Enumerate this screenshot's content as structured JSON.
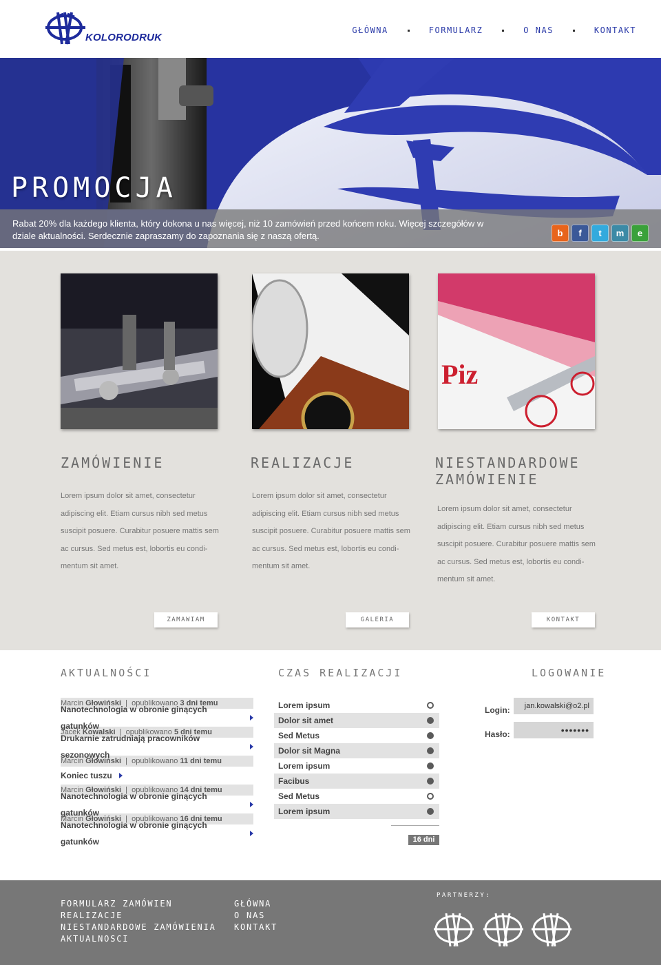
{
  "brand": {
    "name": "KOLORODRUK",
    "color": "#1e2b9c"
  },
  "nav": {
    "items": [
      "GŁÓWNA",
      "FORMULARZ",
      "O NAS",
      "KONTAKT"
    ]
  },
  "hero": {
    "title": "PROMOCJA",
    "text": "Rabat 20% dla każdego klienta, który dokona u nas więcej, niż 10 zamówień przed końcem roku. Więcej szczegółów w dziale aktualności. Serdecznie zapraszamy do zapoznania się z naszą ofertą.",
    "social": [
      {
        "icon": "blogger-icon",
        "glyph": "b",
        "color": "#e8641b"
      },
      {
        "icon": "facebook-icon",
        "glyph": "f",
        "color": "#3b5998"
      },
      {
        "icon": "twitter-icon",
        "glyph": "t",
        "color": "#33aadd"
      },
      {
        "icon": "myspace-icon",
        "glyph": "m",
        "color": "#3c8aa6"
      },
      {
        "icon": "e-icon",
        "glyph": "e",
        "color": "#3aa13a"
      }
    ]
  },
  "features": [
    {
      "title": "ZAMÓWIENIE",
      "desc": "Lorem ipsum dolor sit amet, consectetur adipiscing elit. Etiam cursus nibh sed metus suscipit posuere. Curabitur posuere mattis sem ac cursus. Sed metus est, lobortis eu condi-mentum sit amet.",
      "button": "ZAMAWIAM"
    },
    {
      "title": "REALIZACJE",
      "desc": "Lorem ipsum dolor sit amet, consectetur adipiscing elit. Etiam cursus nibh sed metus suscipit posuere. Curabitur posuere mattis sem ac cursus. Sed metus est, lobortis eu condi-mentum sit amet.",
      "button": "GALERIA"
    },
    {
      "title": "NIESTANDARDOWE ZAMÓWIENIE",
      "desc": "Lorem ipsum dolor sit amet, consectetur adipiscing elit. Etiam cursus nibh sed metus suscipit posuere. Curabitur posuere mattis sem ac cursus. Sed metus est, lobortis eu condi-mentum sit amet.",
      "button": "KONTAKT"
    }
  ],
  "news": {
    "title": "AKTUALNOŚCI",
    "published_label": "opublikowano",
    "items": [
      {
        "first": "Marcin",
        "last": "Głowiński",
        "ago": "3 dni temu",
        "headline": "Nanotechnologia w obronie ginących gatunków"
      },
      {
        "first": "Jacek",
        "last": "Kowalski",
        "ago": "5 dni temu",
        "headline": "Drukarnie zatrudniają pracowników sezonowych"
      },
      {
        "first": "Marcin",
        "last": "Głowiński",
        "ago": "11 dni temu",
        "headline": "Koniec tuszu"
      },
      {
        "first": "Marcin",
        "last": "Głowiński",
        "ago": "14 dni temu",
        "headline": "Nanotechnologia w obronie ginących gatunków"
      },
      {
        "first": "Marcin",
        "last": "Głowiński",
        "ago": "16 dni temu",
        "headline": "Nanotechnologia w obronie ginących gatunków"
      }
    ]
  },
  "times": {
    "title": "CZAS REALIZACJI",
    "items": [
      {
        "label": "Lorem ipsum",
        "selected": true
      },
      {
        "label": "Dolor sit amet",
        "selected": false
      },
      {
        "label": "Sed Metus",
        "selected": false
      },
      {
        "label": "Dolor sit Magna",
        "selected": false
      },
      {
        "label": "Lorem ipsum",
        "selected": false
      },
      {
        "label": "Facibus",
        "selected": false
      },
      {
        "label": "Sed Metus",
        "selected": true
      },
      {
        "label": "Lorem ipsum",
        "selected": false
      }
    ],
    "result": "16 dni"
  },
  "login": {
    "title": "LOGOWANIE",
    "login_label": "Login:",
    "login_value": "jan.kowalski@o2.pl",
    "password_label": "Hasło:",
    "password_value": "•••••••"
  },
  "footer": {
    "col1": [
      "FORMULARZ ZAMÓWIEN",
      "REALIZACJE",
      "NIESTANDARDOWE ZAMÓWIENIA",
      "AKTUALNOSCI"
    ],
    "col2": [
      "GŁÓWNA",
      "O NAS",
      "KONTAKT"
    ],
    "partners_title": "PARTNERZY:"
  }
}
